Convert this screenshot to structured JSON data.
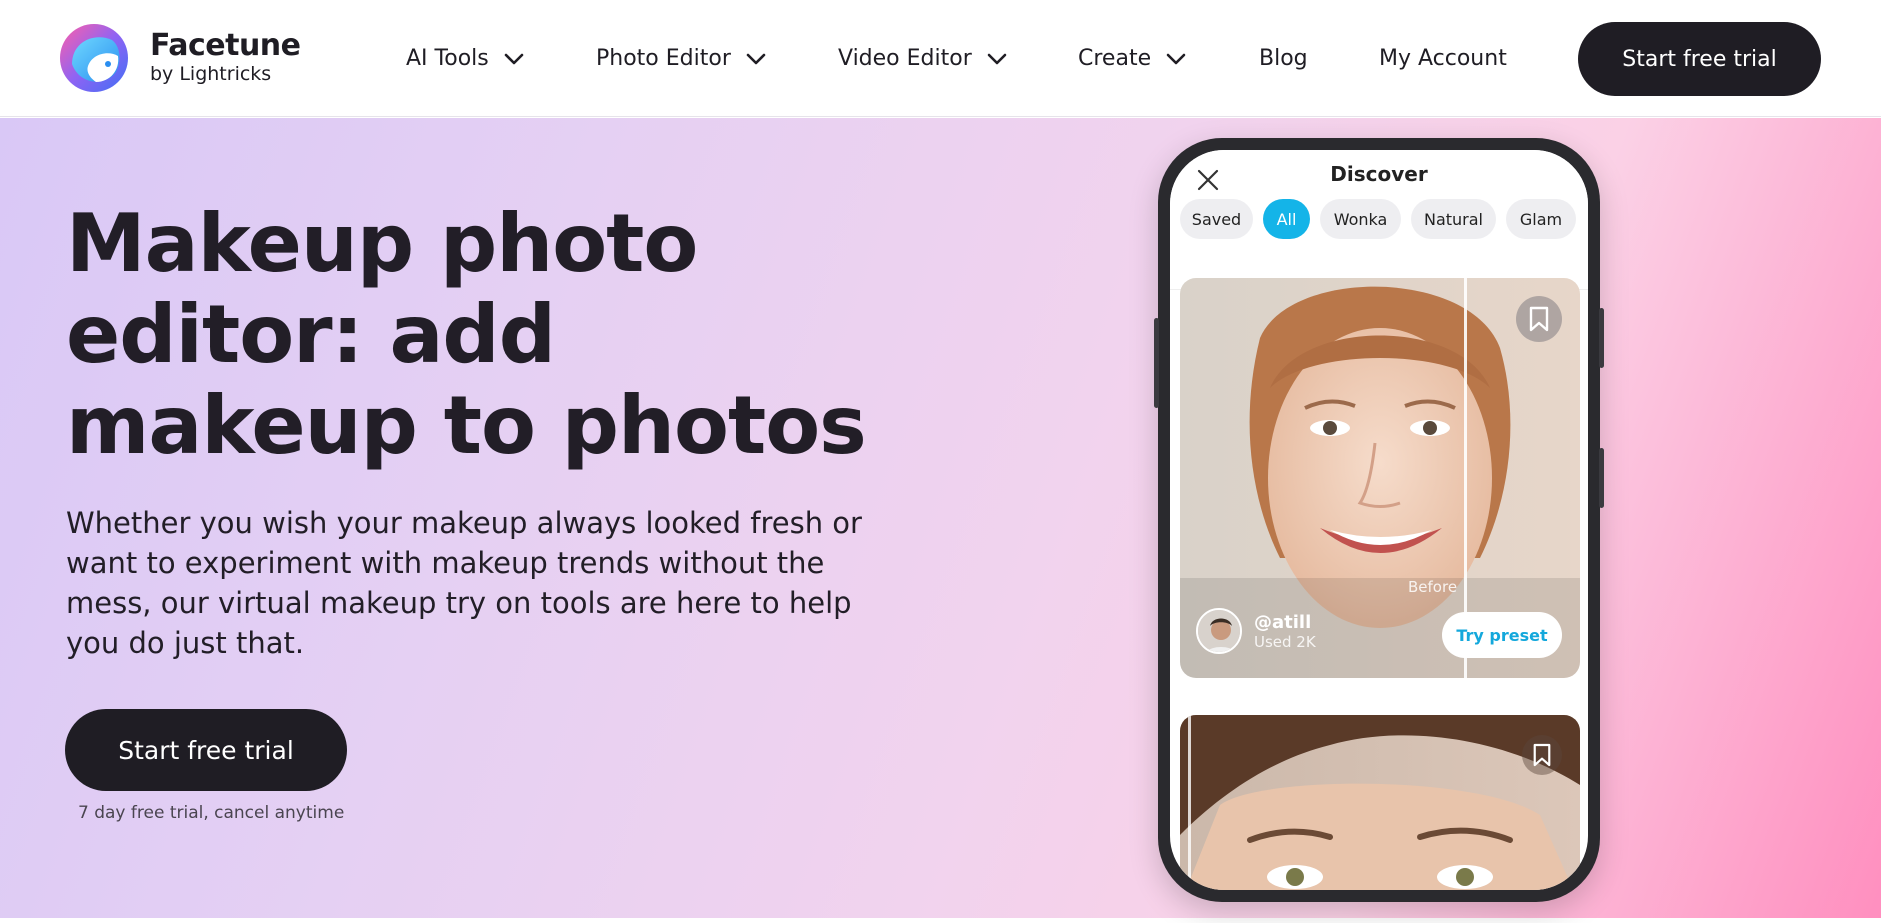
{
  "brand": {
    "name": "Facetune",
    "byline": "by Lightricks"
  },
  "nav": {
    "items": [
      {
        "label": "AI Tools",
        "has_dropdown": true
      },
      {
        "label": "Photo Editor",
        "has_dropdown": true
      },
      {
        "label": "Video Editor",
        "has_dropdown": true
      },
      {
        "label": "Create",
        "has_dropdown": true
      },
      {
        "label": "Blog",
        "has_dropdown": false
      },
      {
        "label": "My Account",
        "has_dropdown": false
      }
    ],
    "cta_label": "Start free trial"
  },
  "hero": {
    "title": "Makeup photo editor: add makeup to photos",
    "description": "Whether you wish your makeup always looked fresh or want to experiment with makeup trends without the mess, our virtual makeup try on tools are here to help you do just that.",
    "cta_label": "Start free trial",
    "note": "7 day free trial, cancel anytime"
  },
  "phone": {
    "screen_title": "Discover",
    "chips": [
      {
        "label": "Saved",
        "active": false
      },
      {
        "label": "All",
        "active": true
      },
      {
        "label": "Wonka",
        "active": false
      },
      {
        "label": "Natural",
        "active": false
      },
      {
        "label": "Glam",
        "active": false
      }
    ],
    "card": {
      "before_label": "Before",
      "handle": "@atill",
      "used": "Used 2K",
      "try_label": "Try preset"
    }
  },
  "colors": {
    "dark": "#1f1d24",
    "accent": "#14b4e8",
    "hero_gradient_start": "#d9c8f6",
    "hero_gradient_end": "#ff8fbf"
  },
  "icons": {
    "dropdown": "chevron-down-icon",
    "close": "close-icon",
    "bookmark": "bookmark-icon"
  }
}
